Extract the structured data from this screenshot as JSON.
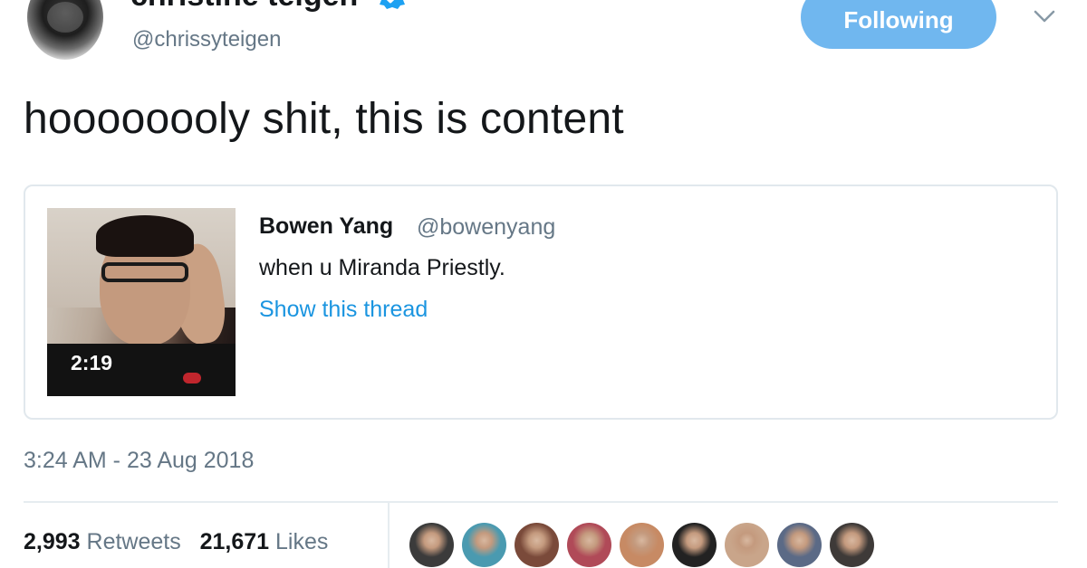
{
  "header": {
    "display_name": "christine teigen",
    "handle": "@chrissyteigen",
    "follow_button": "Following"
  },
  "tweet": {
    "text": "hoooooooly shit, this is content",
    "timestamp": "3:24 AM - 23 Aug 2018"
  },
  "quoted": {
    "name": "Bowen Yang",
    "handle": "@bowenyang",
    "text": "when u Miranda Priestly.",
    "thread_link": "Show this thread",
    "video_duration": "2:19"
  },
  "stats": {
    "retweets_count": "2,993",
    "retweets_label": "Retweets",
    "likes_count": "21,671",
    "likes_label": "Likes"
  },
  "likers": [
    {
      "icon": "avatar-liker-1",
      "color": "#3b3b3b"
    },
    {
      "icon": "avatar-liker-2",
      "color": "#4a9ab0"
    },
    {
      "icon": "avatar-liker-3",
      "color": "#7a4a3a"
    },
    {
      "icon": "avatar-liker-4",
      "color": "#b04a58"
    },
    {
      "icon": "avatar-liker-5",
      "color": "#c78a64"
    },
    {
      "icon": "avatar-liker-6",
      "color": "#222222"
    },
    {
      "icon": "avatar-liker-7",
      "color": "#c9a58a"
    },
    {
      "icon": "avatar-liker-8",
      "color": "#5b6a86"
    },
    {
      "icon": "avatar-liker-9",
      "color": "#3e3a38"
    }
  ],
  "colors": {
    "accent": "#1b95e0",
    "follow_button": "#70b7ef",
    "secondary_text": "#657786",
    "border": "#e1e8ed"
  }
}
